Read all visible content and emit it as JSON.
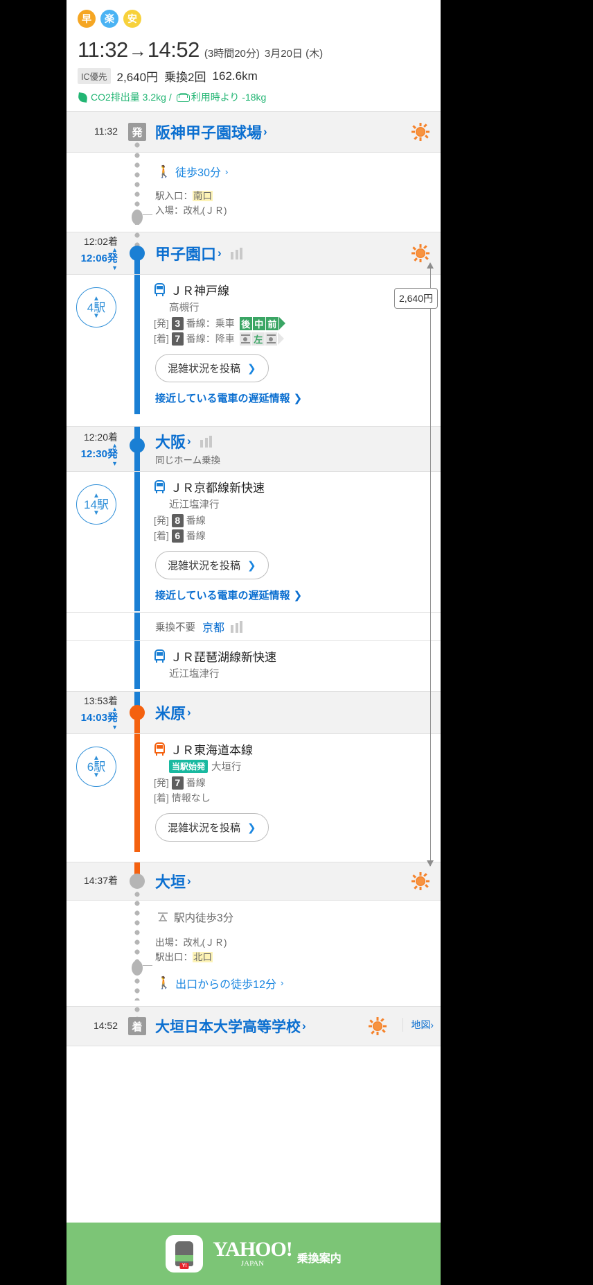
{
  "header": {
    "badges": [
      {
        "label": "早",
        "color": "#f5a623",
        "name": "fastest"
      },
      {
        "label": "楽",
        "color": "#4ab3f4",
        "name": "easiest"
      },
      {
        "label": "安",
        "color": "#f7d13b",
        "name": "cheapest"
      }
    ],
    "depart_time": "11:32",
    "arrow": "→",
    "arrive_time": "14:52",
    "duration": "(3時間20分)",
    "date": "3月20日 (木)",
    "ic_tag": "IC優先",
    "fare": "2,640円",
    "transfers": "乗換2回",
    "distance": "162.6km",
    "co2_text": "CO2排出量 3.2kg /",
    "co2_compare": "利用時より -18kg",
    "co2_color": "#22b573"
  },
  "steps": {
    "origin": {
      "time": "11:32",
      "tag": "発",
      "name": "阪神甲子園球場",
      "chevron": "›"
    },
    "walk1": {
      "label": "徒歩30分",
      "chevron": "›",
      "entrance_label": "駅入口：",
      "entrance_value": "南口",
      "gate_label": "入場：改札(ＪＲ)"
    },
    "station2": {
      "arrive": "12:02着",
      "depart": "12:06発",
      "name": "甲子園口",
      "chevron": "›"
    },
    "train1": {
      "station_count": "4駅",
      "line_name": "ＪＲ神戸線",
      "destination": "高槻行",
      "dep_prefix": "[発]",
      "dep_platform": "3",
      "dep_suffix": "番線：乗車",
      "dep_pos": [
        "後",
        "中",
        "前"
      ],
      "arr_prefix": "[着]",
      "arr_platform": "7",
      "arr_suffix": "番線：降車",
      "arr_pos_label": "左",
      "congestion_button": "混雑状況を投稿",
      "delay_link": "接近している電車の遅延情報",
      "chevron": "›"
    },
    "station3": {
      "arrive": "12:20着",
      "depart": "12:30発",
      "name": "大阪",
      "chevron": "›",
      "note": "同じホーム乗換"
    },
    "train2": {
      "station_count": "14駅",
      "line_name": "ＪＲ京都線新快速",
      "destination": "近江塩津行",
      "dep_prefix": "[発]",
      "dep_platform": "8",
      "dep_suffix": "番線",
      "arr_prefix": "[着]",
      "arr_platform": "6",
      "arr_suffix": "番線",
      "congestion_button": "混雑状況を投稿",
      "delay_link": "接近している電車の遅延情報",
      "chevron": "›"
    },
    "nochange": {
      "label": "乗換不要",
      "station": "京都"
    },
    "train2b": {
      "line_name": "ＪＲ琵琶湖線新快速",
      "destination": "近江塩津行"
    },
    "station4": {
      "arrive": "13:53着",
      "depart": "14:03発",
      "name": "米原",
      "chevron": "›"
    },
    "train3": {
      "station_count": "6駅",
      "line_name": "ＪＲ東海道本線",
      "start_tag": "当駅始発",
      "destination": "大垣行",
      "dep_prefix": "[発]",
      "dep_platform": "7",
      "dep_suffix": "番線",
      "arr_prefix": "[着]",
      "arr_text": "情報なし",
      "congestion_button": "混雑状況を投稿",
      "chevron": "›"
    },
    "station5": {
      "arrive": "14:37着",
      "name": "大垣",
      "chevron": "›"
    },
    "walk2": {
      "in_station": "駅内徒歩3分",
      "exit_gate_label": "出場：改札(ＪＲ)",
      "exit_label": "駅出口：",
      "exit_value": "北口",
      "walk_label": "出口からの徒歩12分",
      "chevron": "›"
    },
    "destination": {
      "time": "14:52",
      "tag": "着",
      "name": "大垣日本大学高等学校",
      "chevron": "›",
      "map_label": "地図",
      "map_chevron": "›"
    }
  },
  "fare_marker": {
    "value": "2,640円"
  },
  "footer": {
    "brand": "YAHOO!",
    "brand_sub": "JAPAN",
    "service": "乗換案内"
  },
  "icons": {
    "sun": "sun-icon",
    "walk": "walking-person-icon",
    "train": "train-icon",
    "chevron": "chevron-right-icon"
  }
}
